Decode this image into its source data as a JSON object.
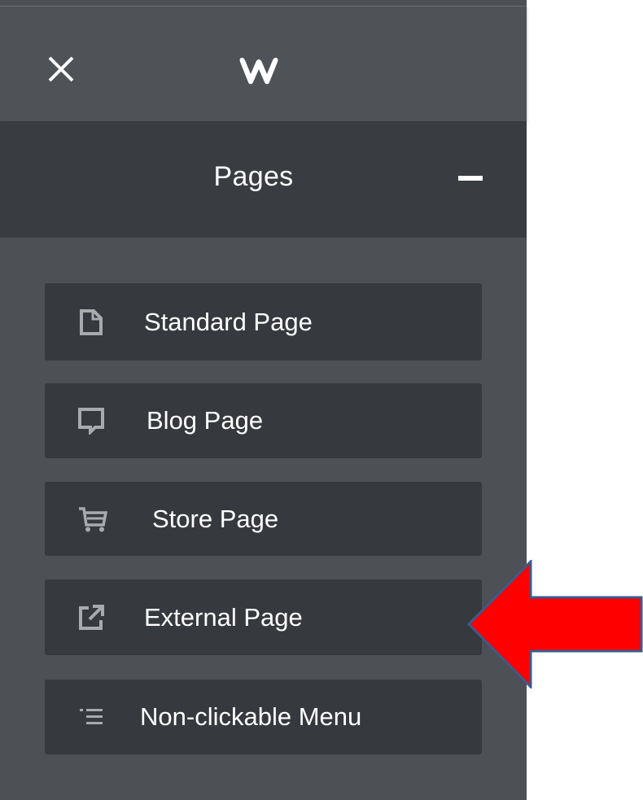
{
  "header": {
    "close_icon": "close-icon",
    "logo_icon": "weebly-logo"
  },
  "section": {
    "title": "Pages",
    "collapse_icon": "minus-icon"
  },
  "page_types": [
    {
      "label": "Standard Page",
      "icon": "document-icon"
    },
    {
      "label": "Blog Page",
      "icon": "chat-bubble-icon"
    },
    {
      "label": "Store Page",
      "icon": "cart-icon"
    },
    {
      "label": "External Page",
      "icon": "external-link-icon"
    },
    {
      "label": "Non-clickable Menu",
      "icon": "menu-list-icon"
    }
  ],
  "annotation": {
    "arrow_color": "#ff0000",
    "arrow_outline": "#3a5b8c",
    "points_to": "External Page"
  },
  "colors": {
    "panel_bg": "#4d5054",
    "header_bg": "#393c40",
    "item_bg": "#36393d",
    "text": "#ffffff",
    "icon": "#a8abad"
  }
}
